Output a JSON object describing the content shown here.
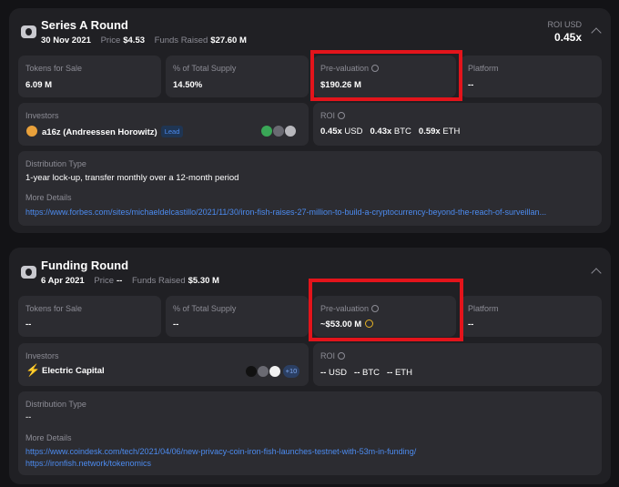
{
  "round1": {
    "title": "Series A Round",
    "date": "30 Nov 2021",
    "price_label": "Price",
    "price": "$4.53",
    "funds_label": "Funds Raised",
    "funds": "$27.60 M",
    "roi_label": "ROI USD",
    "roi_value": "0.45x",
    "tokens_label": "Tokens for Sale",
    "tokens": "6.09 M",
    "supply_label": "% of Total Supply",
    "supply": "14.50%",
    "preval_label": "Pre-valuation",
    "preval": "$190.26 M",
    "platform_label": "Platform",
    "platform": "--",
    "investors_label": "Investors",
    "investor_name": "a16z (Andreessen Horowitz)",
    "investor_badge": "Lead",
    "roi2_label": "ROI",
    "roi_usd": "0.45x",
    "roi_usd_unit": "USD",
    "roi_btc": "0.43x",
    "roi_btc_unit": "BTC",
    "roi_eth": "0.59x",
    "roi_eth_unit": "ETH",
    "dist_label": "Distribution Type",
    "dist_value": "1-year lock-up, transfer monthly over a 12-month period",
    "details_label": "More Details",
    "details_link": "https://www.forbes.com/sites/michaeldelcastillo/2021/11/30/iron-fish-raises-27-million-to-build-a-cryptocurrency-beyond-the-reach-of-surveillan..."
  },
  "round2": {
    "title": "Funding Round",
    "date": "6 Apr 2021",
    "price_label": "Price",
    "price": "--",
    "funds_label": "Funds Raised",
    "funds": "$5.30 M",
    "tokens_label": "Tokens for Sale",
    "tokens": "--",
    "supply_label": "% of Total Supply",
    "supply": "--",
    "preval_label": "Pre-valuation",
    "preval": "~$53.00 M",
    "platform_label": "Platform",
    "platform": "--",
    "investors_label": "Investors",
    "investor_name": "Electric Capital",
    "investor_more": "+10",
    "roi2_label": "ROI",
    "roi_usd": "--",
    "roi_usd_unit": "USD",
    "roi_btc": "--",
    "roi_btc_unit": "BTC",
    "roi_eth": "--",
    "roi_eth_unit": "ETH",
    "dist_label": "Distribution Type",
    "dist_value": "--",
    "details_label": "More Details",
    "details_link1": "https://www.coindesk.com/tech/2021/04/06/new-privacy-coin-iron-fish-launches-testnet-with-53m-in-funding/",
    "details_link2": "https://ironfish.network/tokenomics"
  },
  "colors": {
    "highlight": "#e3141b",
    "link": "#4c8bef",
    "card": "#202024",
    "cell": "#2c2c31"
  }
}
